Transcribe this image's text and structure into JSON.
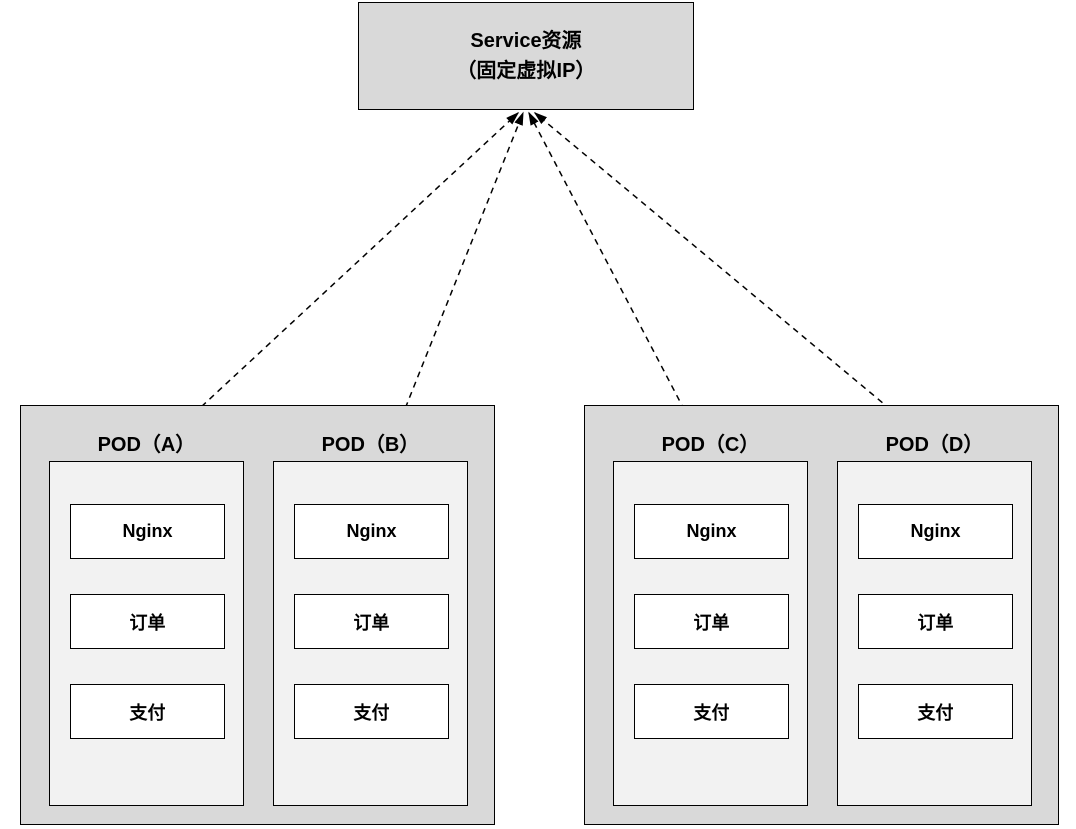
{
  "service": {
    "line1": "Service资源",
    "line2": "（固定虚拟IP）"
  },
  "pods": [
    {
      "name": "POD（A）",
      "items": [
        "Nginx",
        "订单",
        "支付"
      ]
    },
    {
      "name": "POD（B）",
      "items": [
        "Nginx",
        "订单",
        "支付"
      ]
    },
    {
      "name": "POD（C）",
      "items": [
        "Nginx",
        "订单",
        "支付"
      ]
    },
    {
      "name": "POD（D）",
      "items": [
        "Nginx",
        "订单",
        "支付"
      ]
    }
  ]
}
